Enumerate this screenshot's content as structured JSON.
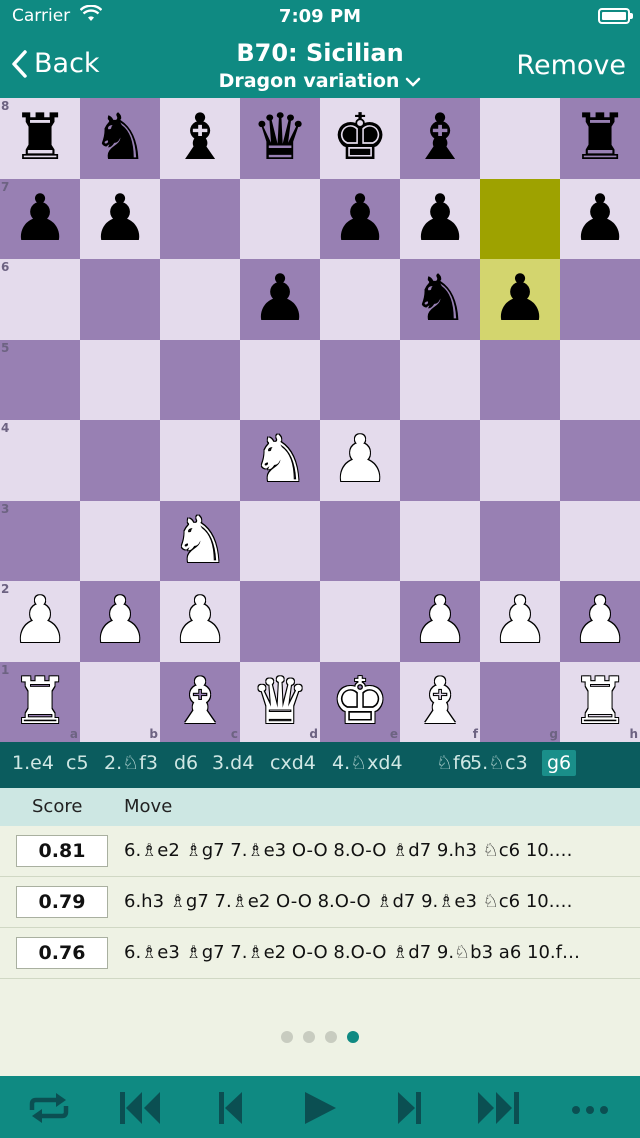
{
  "status": {
    "carrier": "Carrier",
    "time": "7:09 PM"
  },
  "nav": {
    "back_label": "Back",
    "title": "B70: Sicilian",
    "subtitle": "Dragon variation",
    "remove_label": "Remove"
  },
  "board": {
    "ranks": [
      "8",
      "7",
      "6",
      "5",
      "4",
      "3",
      "2",
      "1"
    ],
    "files": [
      "a",
      "b",
      "c",
      "d",
      "e",
      "f",
      "g",
      "h"
    ],
    "highlight_from": "g7",
    "highlight_to": "g6",
    "pieces": [
      {
        "sq": "a8",
        "glyph": "♜",
        "color": "black"
      },
      {
        "sq": "b8",
        "glyph": "♞",
        "color": "black"
      },
      {
        "sq": "c8",
        "glyph": "♝",
        "color": "black"
      },
      {
        "sq": "d8",
        "glyph": "♛",
        "color": "black"
      },
      {
        "sq": "e8",
        "glyph": "♚",
        "color": "black"
      },
      {
        "sq": "f8",
        "glyph": "♝",
        "color": "black"
      },
      {
        "sq": "h8",
        "glyph": "♜",
        "color": "black"
      },
      {
        "sq": "a7",
        "glyph": "♟",
        "color": "black"
      },
      {
        "sq": "b7",
        "glyph": "♟",
        "color": "black"
      },
      {
        "sq": "e7",
        "glyph": "♟",
        "color": "black"
      },
      {
        "sq": "f7",
        "glyph": "♟",
        "color": "black"
      },
      {
        "sq": "h7",
        "glyph": "♟",
        "color": "black"
      },
      {
        "sq": "d6",
        "glyph": "♟",
        "color": "black"
      },
      {
        "sq": "f6",
        "glyph": "♞",
        "color": "black"
      },
      {
        "sq": "g6",
        "glyph": "♟",
        "color": "black"
      },
      {
        "sq": "d4",
        "glyph": "♞",
        "color": "white"
      },
      {
        "sq": "e4",
        "glyph": "♟",
        "color": "white"
      },
      {
        "sq": "c3",
        "glyph": "♞",
        "color": "white"
      },
      {
        "sq": "a2",
        "glyph": "♟",
        "color": "white"
      },
      {
        "sq": "b2",
        "glyph": "♟",
        "color": "white"
      },
      {
        "sq": "c2",
        "glyph": "♟",
        "color": "white"
      },
      {
        "sq": "f2",
        "glyph": "♟",
        "color": "white"
      },
      {
        "sq": "g2",
        "glyph": "♟",
        "color": "white"
      },
      {
        "sq": "h2",
        "glyph": "♟",
        "color": "white"
      },
      {
        "sq": "a1",
        "glyph": "♜",
        "color": "white"
      },
      {
        "sq": "c1",
        "glyph": "♝",
        "color": "white"
      },
      {
        "sq": "d1",
        "glyph": "♛",
        "color": "white"
      },
      {
        "sq": "e1",
        "glyph": "♚",
        "color": "white"
      },
      {
        "sq": "f1",
        "glyph": "♝",
        "color": "white"
      },
      {
        "sq": "h1",
        "glyph": "♜",
        "color": "white"
      }
    ]
  },
  "moves": [
    "1.e4",
    "c5",
    "2.♘f3",
    "d6",
    "3.d4",
    "cxd4",
    "4.♘xd4",
    "♘f6",
    "5.♘c3",
    "g6"
  ],
  "selected_move": "g6",
  "analysis": {
    "score_header": "Score",
    "move_header": "Move",
    "lines": [
      {
        "score": "0.81",
        "pv": "6.♗e2 ♗g7 7.♗e3 O-O 8.O-O ♗d7 9.h3 ♘c6 10.…"
      },
      {
        "score": "0.79",
        "pv": "6.h3 ♗g7 7.♗e2 O-O 8.O-O ♗d7 9.♗e3 ♘c6 10.…"
      },
      {
        "score": "0.76",
        "pv": "6.♗e3 ♗g7 7.♗e2 O-O 8.O-O ♗d7 9.♘b3 a6 10.f…"
      }
    ]
  },
  "pager": {
    "count": 4,
    "active": 3
  },
  "toolbar": [
    "flip-board-icon",
    "first-move-icon",
    "previous-move-icon",
    "play-icon",
    "next-move-icon",
    "last-move-icon",
    "more-icon"
  ],
  "colors": {
    "accent": "#0f8a82",
    "light_square": "#e4dbec",
    "dark_square": "#9880b3",
    "highlight_from": "#9ea200",
    "highlight_to": "#d3d56e"
  }
}
